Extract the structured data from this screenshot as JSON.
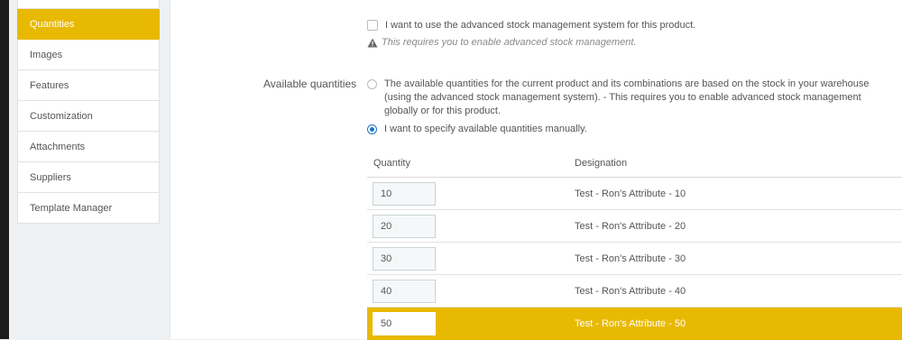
{
  "sidebar": {
    "items": [
      {
        "label": "Quantities",
        "active": true
      },
      {
        "label": "Images"
      },
      {
        "label": "Features"
      },
      {
        "label": "Customization"
      },
      {
        "label": "Attachments"
      },
      {
        "label": "Suppliers"
      },
      {
        "label": "Template Manager"
      }
    ]
  },
  "stock": {
    "advanced_checkbox_label": "I want to use the advanced stock management system for this product.",
    "advanced_checkbox_checked": false,
    "note": "This requires you to enable advanced stock management."
  },
  "available_quantities": {
    "label": "Available quantities",
    "option_warehouse": "The available quantities for the current product and its combinations are based on the stock in your warehouse (using the advanced stock management system).  - This requires you to enable advanced stock management globally or for this product.",
    "option_manual": "I want to specify available quantities manually.",
    "selected": "manual"
  },
  "table": {
    "headers": {
      "quantity": "Quantity",
      "designation": "Designation"
    },
    "rows": [
      {
        "quantity": "10",
        "designation": "Test - Ron's Attribute - 10"
      },
      {
        "quantity": "20",
        "designation": "Test - Ron's Attribute - 20"
      },
      {
        "quantity": "30",
        "designation": "Test - Ron's Attribute - 30"
      },
      {
        "quantity": "40",
        "designation": "Test - Ron's Attribute - 40"
      },
      {
        "quantity": "50",
        "designation": "Test - Ron's Attribute - 50",
        "highlighted": true
      }
    ]
  },
  "colors": {
    "accent": "#e8b902",
    "radio_selected": "#1e73c8"
  }
}
